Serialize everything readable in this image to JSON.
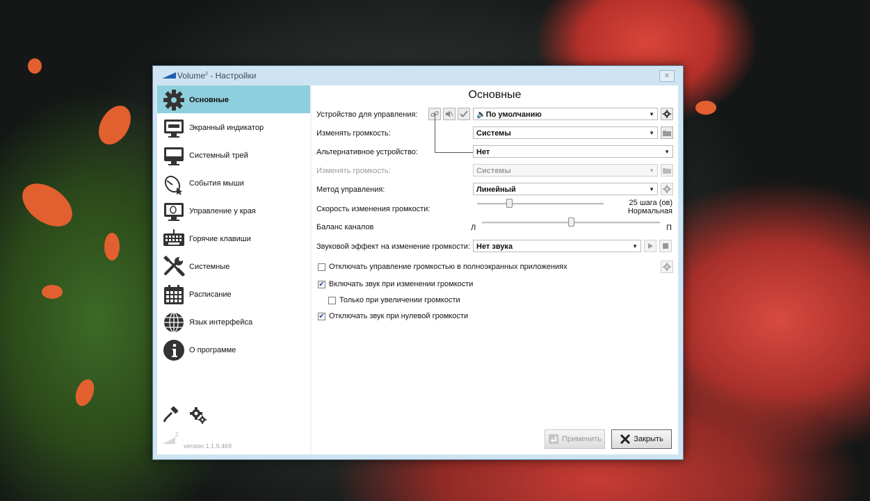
{
  "window": {
    "title": "Volume",
    "title_sup": "2",
    "title_suffix": " - Настройки",
    "close_label": "✕"
  },
  "sidebar": {
    "items": [
      {
        "label": "Основные",
        "icon": "gear-icon"
      },
      {
        "label": "Экранный индикатор",
        "icon": "monitor-icon"
      },
      {
        "label": "Системный трей",
        "icon": "tray-icon"
      },
      {
        "label": "События мыши",
        "icon": "mouse-icon"
      },
      {
        "label": "Управление у края",
        "icon": "screen-edge-icon"
      },
      {
        "label": "Горячие клавиши",
        "icon": "keyboard-icon"
      },
      {
        "label": "Системные",
        "icon": "tools-icon"
      },
      {
        "label": "Расписание",
        "icon": "calendar-icon"
      },
      {
        "label": "Язык интерфейса",
        "icon": "globe-icon"
      },
      {
        "label": "О программе",
        "icon": "info-icon"
      }
    ],
    "version": "version 1.1.9.469",
    "version_logo_sup": "2"
  },
  "panel": {
    "title": "Основные",
    "device_label": "Устройство для управления:",
    "device_value": "🔈По умолчанию",
    "change_volume_label": "Изменять громкость:",
    "change_volume_value": "Системы",
    "alt_device_label": "Альтернативное устройство:",
    "alt_device_value": "Нет",
    "alt_change_volume_label": "Изменять громкость:",
    "alt_change_volume_value": "Системы",
    "method_label": "Метод управления:",
    "method_value": "Линейный",
    "speed_label": "Скорость изменения громкости:",
    "speed_value": "25 шага (ов)",
    "speed_caption": "Нормальная",
    "speed_fraction": 0.25,
    "balance_label": "Баланс каналов",
    "balance_left": "Л",
    "balance_right": "П",
    "balance_fraction": 0.5,
    "sound_effect_label": "Звуковой эффект на изменение громкости:",
    "sound_effect_value": "Нет звука",
    "checkboxes": [
      {
        "label": "Отключать управление громкостью в полноэкранных приложениях",
        "checked": false
      },
      {
        "label": "Включать звук при изменении громкости",
        "checked": true
      },
      {
        "label": "Только при увеличении громкости",
        "checked": false
      },
      {
        "label": "Отключать звук при нулевой громкости",
        "checked": true
      }
    ]
  },
  "footer": {
    "apply_label": "Применить",
    "close_label": "Закрыть"
  },
  "colors": {
    "accent": "#8ecfde",
    "frame": "#cfe4f2"
  }
}
